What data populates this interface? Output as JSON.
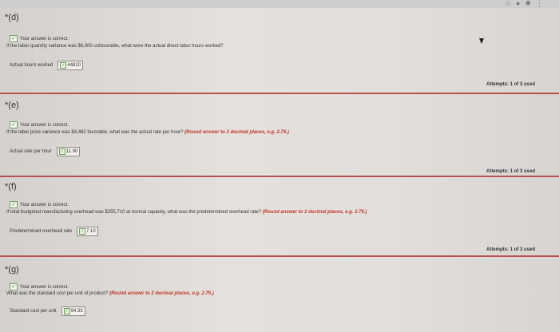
{
  "browser": {
    "icons": [
      "star-icon",
      "record-icon",
      "extension-icon",
      "menu-icon"
    ]
  },
  "parts": [
    {
      "label": "*(d)",
      "correct": "Your answer is correct.",
      "question": "If the labor quantity variance was $6,000 unfavorable, what were the actual direct labor hours worked?",
      "hint": "",
      "answer_label": "Actual hours worked",
      "answer_value": "44820",
      "attempts": "Attempts: 1 of 3 used"
    },
    {
      "label": "*(e)",
      "correct": "Your answer is correct.",
      "question": "If the labor price variance was $4,482 favorable, what was the actual rate per hour?",
      "hint": "(Round answer to 2 decimal places, e.g. 2.75.)",
      "answer_label": "Actual rate per hour",
      "answer_value": "11.90",
      "attempts": "Attempts: 1 of 3 used"
    },
    {
      "label": "*(f)",
      "correct": "Your answer is correct.",
      "question": "If total budgeted manufacturing overhead was $355,710 at normal capacity, what was the predetermined overhead rate?",
      "hint": "(Round answer to 2 decimal places, e.g. 2.75.)",
      "answer_label": "Predetermined overhead rate",
      "answer_value": "7.10",
      "attempts": "Attempts: 1 of 3 used"
    },
    {
      "label": "*(g)",
      "correct": "Your answer is correct.",
      "question": "What was the standard cost per unit of product?",
      "hint": "(Round answer to 2 decimal places, e.g. 2.75.)",
      "answer_label": "Standard cost per unit",
      "answer_value": "94.33",
      "attempts": ""
    }
  ]
}
